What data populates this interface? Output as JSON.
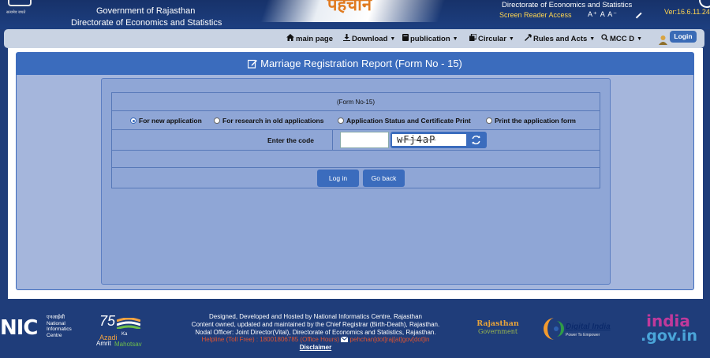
{
  "header": {
    "emblem_caption": "सत्यमेव जयते",
    "gov_title": "Government of Rajasthan",
    "dept_title": "Directorate of Economics and Statistics",
    "banner_text": "पहचान",
    "dir_right": "Directorate of Economics and Statistics",
    "screen_reader": "Screen Reader Access",
    "font_controls": "A⁺ A A⁻",
    "version": "Ver:16.6.11.24"
  },
  "nav": {
    "main_page": "main page",
    "download": "Download",
    "publication": "publication",
    "circular": "Circular",
    "rules": "Rules and Acts",
    "mcc": "MCC D",
    "login": "Login"
  },
  "panel": {
    "title": "Marriage Registration Report (Form No - 15)",
    "form_no": "(Form No-15)",
    "options": [
      "For new application",
      "For research in old applications",
      "Application Status and Certificate Print",
      "Print the application form"
    ],
    "selected_option": "For new application",
    "code_label": "Enter the code",
    "code_value": "",
    "captcha_text": "wFj4aP",
    "login_button": "Log in",
    "back_button": "Go back"
  },
  "footer": {
    "nic_hindi": "एनआईसी",
    "nic_name_1": "National",
    "nic_name_2": "Informatics",
    "nic_name_3": "Centre",
    "nic_logo": "NIC",
    "azadi_75": "75",
    "azadi_1": "Azadi",
    "azadi_ka": "Ka",
    "azadi_2": "Amrit",
    "azadi_3": "Mahotsav",
    "line1": "Designed, Developed and Hosted by National Informatics Centre, Rajasthan",
    "line2": "Content owned, updated and maintained by the Chief Registrar (Birth-Death), Rajasthan.",
    "line3": "Nodal Officer: Joint Director(Vital), Directorate of Economics and Statistics, Rajasthan.",
    "helpline": "Helpline (Toll Free) : 18001806785 (Office Hours)",
    "email": "pehchan[dot]raj[at]gov[dot]in",
    "disclaimer": "Disclaimer",
    "rajasthan_1": "Rajasthan",
    "rajasthan_2": "Government",
    "digital_india": "Digital India",
    "digital_india_sub": "Power To Empower",
    "india_gov_1": "india",
    "india_gov_2": ".gov.in"
  },
  "colors": {
    "header_bg": "#1d3f80",
    "panel_header": "#3b6cbd",
    "panel_bg": "#a5b6dc",
    "nav_bg": "#c9d3e3",
    "version_text": "#ffd54f",
    "helpline_text": "#e2532f"
  }
}
